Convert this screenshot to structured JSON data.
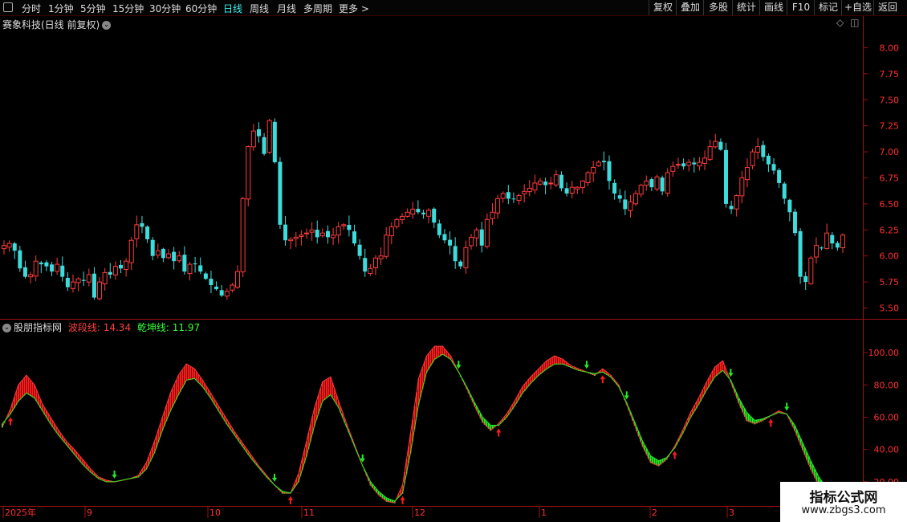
{
  "toolbar": {
    "left_items": [
      {
        "label": "分时",
        "active": false
      },
      {
        "label": "1分钟",
        "active": false
      },
      {
        "label": "5分钟",
        "active": false
      },
      {
        "label": "15分钟",
        "active": false
      },
      {
        "label": "30分钟",
        "active": false
      },
      {
        "label": "60分钟",
        "active": false
      },
      {
        "label": "日线",
        "active": true
      },
      {
        "label": "周线",
        "active": false
      },
      {
        "label": "月线",
        "active": false
      },
      {
        "label": "多周期",
        "active": false
      },
      {
        "label": "更多 >",
        "active": false
      }
    ],
    "right_items": [
      "复权",
      "叠加",
      "多股",
      "统计",
      "画线",
      "F10",
      "标记",
      "+自选",
      "返回"
    ]
  },
  "main_panel": {
    "title": "赛象科技(日线 前复权)",
    "y_ticks": [
      "8.00",
      "7.75",
      "7.50",
      "7.25",
      "7.00",
      "6.75",
      "6.50",
      "6.25",
      "6.00",
      "5.75",
      "5.50"
    ]
  },
  "indicator_panel": {
    "name": "股朋指标网",
    "line1_label": "波段线:",
    "line1_value": "14.34",
    "line2_label": "乾坤线:",
    "line2_value": "11.97",
    "y_ticks": [
      "100.00",
      "80.00",
      "60.00",
      "40.00",
      "20.00"
    ]
  },
  "x_axis": {
    "labels": [
      "2025年",
      "9",
      "10",
      "11",
      "12",
      "1",
      "2",
      "3"
    ]
  },
  "watermark": {
    "title": "指标公式网",
    "url": "www.zbgs3.com"
  },
  "colors": {
    "up": "#ff3b3b",
    "down": "#3ddcdc",
    "band_up": "#ff1a1a",
    "band_down": "#22ee22",
    "active_tab": "#3df0f0",
    "line1_label": "#ff4040",
    "line2_label": "#33ff33"
  },
  "chart_data": [
    {
      "type": "candlestick",
      "title": "赛象科技(日线 前复权)",
      "ylim": [
        5.45,
        8.15
      ],
      "y_ticks": [
        5.5,
        5.75,
        6.0,
        6.25,
        6.5,
        6.75,
        7.0,
        7.25,
        7.5,
        7.75,
        8.0
      ],
      "closes": [
        6.1,
        6.12,
        6.05,
        5.88,
        5.8,
        5.82,
        5.95,
        5.92,
        5.9,
        5.85,
        5.92,
        5.8,
        5.7,
        5.75,
        5.78,
        5.76,
        5.82,
        5.6,
        5.75,
        5.84,
        5.82,
        5.9,
        5.88,
        5.95,
        6.15,
        6.3,
        6.28,
        6.16,
        6.0,
        6.05,
        5.98,
        6.02,
        5.95,
        6.0,
        5.85,
        5.92,
        5.92,
        5.85,
        5.78,
        5.72,
        5.68,
        5.62,
        5.66,
        5.72,
        5.85,
        6.55,
        7.05,
        7.2,
        7.15,
        6.98,
        7.3,
        6.9,
        6.3,
        6.15,
        6.16,
        6.18,
        6.2,
        6.22,
        6.25,
        6.18,
        6.22,
        6.18,
        6.2,
        6.28,
        6.3,
        6.25,
        6.12,
        6.0,
        5.85,
        5.88,
        5.98,
        6.0,
        6.2,
        6.28,
        6.35,
        6.38,
        6.42,
        6.45,
        6.42,
        6.4,
        6.44,
        6.32,
        6.2,
        6.15,
        6.1,
        5.95,
        5.9,
        6.08,
        6.18,
        6.25,
        6.1,
        6.35,
        6.42,
        6.55,
        6.6,
        6.55,
        6.55,
        6.58,
        6.62,
        6.65,
        6.7,
        6.72,
        6.68,
        6.7,
        6.78,
        6.65,
        6.6,
        6.66,
        6.66,
        6.72,
        6.8,
        6.85,
        6.9,
        6.9,
        6.72,
        6.6,
        6.55,
        6.45,
        6.52,
        6.6,
        6.68,
        6.72,
        6.66,
        6.76,
        6.62,
        6.8,
        6.86,
        6.88,
        6.86,
        6.9,
        6.88,
        6.9,
        6.94,
        7.05,
        7.1,
        7.02,
        6.5,
        6.45,
        6.58,
        6.75,
        6.85,
        7.0,
        7.05,
        6.95,
        6.88,
        6.82,
        6.7,
        6.55,
        6.42,
        6.22,
        5.8,
        5.75,
        5.98,
        6.1,
        6.08,
        6.22,
        6.12,
        6.08,
        6.2
      ]
    },
    {
      "type": "line",
      "series": [
        {
          "name": "波段线",
          "color": "#ff3b3b",
          "values": [
            54,
            65,
            80,
            86,
            80,
            68,
            60,
            52,
            45,
            40,
            34,
            28,
            23,
            21,
            20,
            21,
            22,
            24,
            32,
            45,
            60,
            75,
            86,
            93,
            90,
            83,
            75,
            67,
            59,
            51,
            44,
            37,
            30,
            24,
            18,
            13,
            13,
            25,
            45,
            66,
            82,
            85,
            70,
            56,
            43,
            30,
            18,
            12,
            8,
            7,
            18,
            50,
            84,
            98,
            104,
            104,
            98,
            88,
            78,
            67,
            57,
            52,
            56,
            62,
            70,
            79,
            85,
            90,
            95,
            98,
            96,
            92,
            90,
            88,
            86,
            90,
            86,
            80,
            68,
            55,
            42,
            32,
            30,
            34,
            42,
            52,
            63,
            72,
            82,
            91,
            95,
            82,
            69,
            58,
            56,
            58,
            61,
            64,
            62,
            52,
            40,
            28,
            18,
            12,
            12,
            14
          ]
        },
        {
          "name": "乾坤线",
          "color": "#22ee22",
          "values": [
            56,
            62,
            70,
            75,
            72,
            64,
            56,
            49,
            43,
            37,
            31,
            26,
            22,
            20,
            20,
            21,
            22,
            23,
            28,
            38,
            52,
            64,
            74,
            83,
            84,
            79,
            72,
            64,
            56,
            49,
            42,
            35,
            29,
            23,
            18,
            14,
            13,
            20,
            36,
            55,
            70,
            74,
            66,
            54,
            42,
            30,
            20,
            14,
            10,
            8,
            13,
            38,
            68,
            88,
            96,
            99,
            96,
            88,
            79,
            69,
            60,
            55,
            55,
            60,
            67,
            75,
            81,
            86,
            90,
            93,
            93,
            91,
            89,
            88,
            87,
            88,
            85,
            79,
            69,
            57,
            45,
            36,
            33,
            35,
            41,
            50,
            60,
            68,
            77,
            85,
            89,
            83,
            72,
            63,
            58,
            59,
            61,
            63,
            62,
            55,
            44,
            33,
            23,
            16,
            14,
            14
          ]
        }
      ],
      "ylim": [
        6,
        112
      ],
      "y_ticks": [
        20,
        40,
        60,
        80,
        100
      ]
    }
  ]
}
